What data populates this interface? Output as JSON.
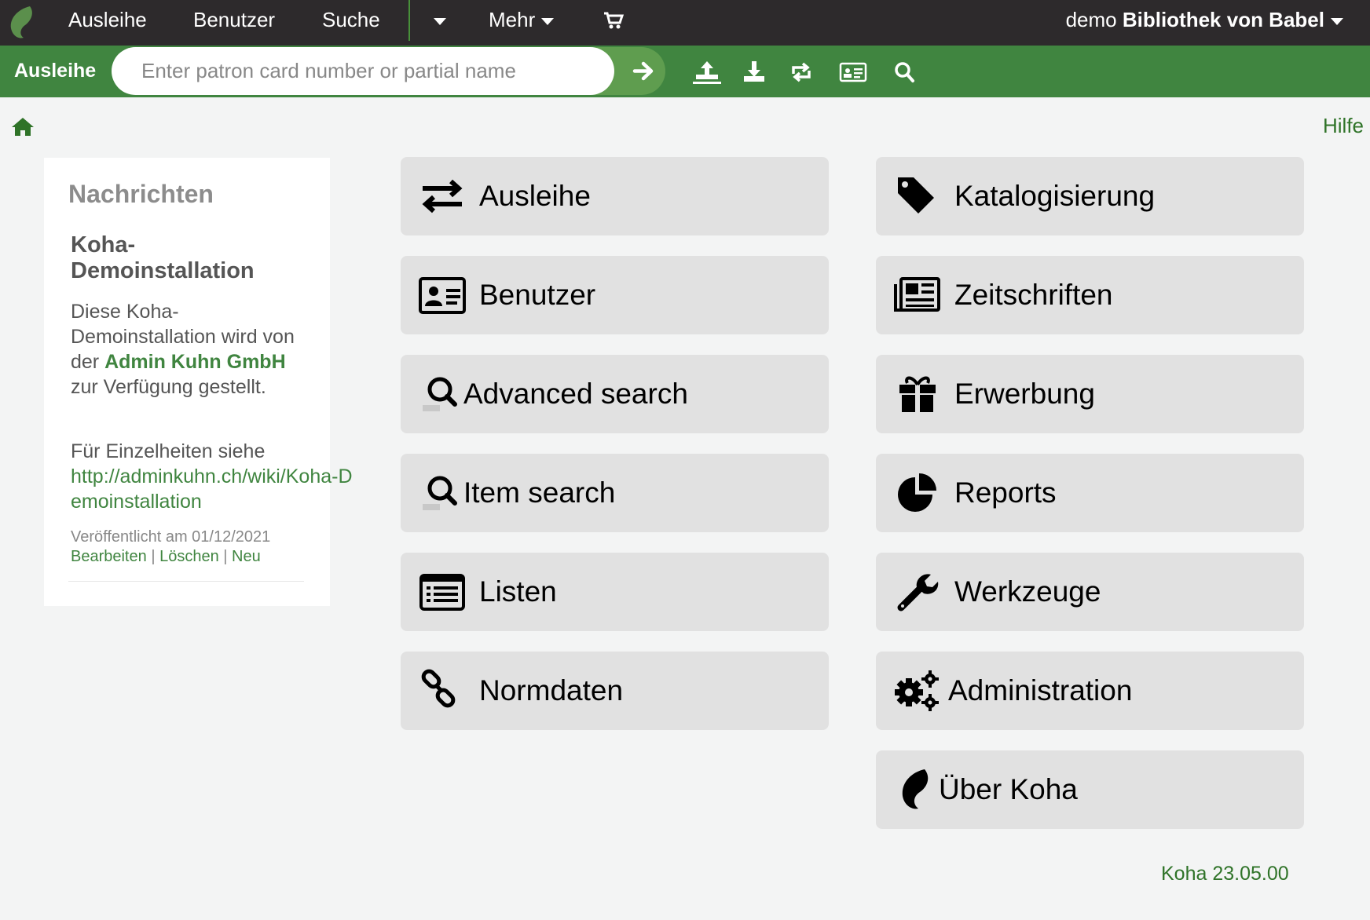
{
  "topnav": {
    "items": [
      "Ausleihe",
      "Benutzer",
      "Suche"
    ],
    "more_label": "Mehr",
    "library_user": "demo",
    "library_name": "Bibliothek von Babel"
  },
  "header": {
    "module_label": "Ausleihe",
    "search_placeholder": "Enter patron card number or partial name",
    "search_value": ""
  },
  "breadcrumb": {
    "help_label": "Hilfe"
  },
  "news": {
    "title": "Nachrichten",
    "item_title": "Koha-Demoinstallation",
    "body_prefix": "Diese Koha-Demoinstallation wird von der ",
    "body_bold": "Admin Kuhn GmbH",
    "body_suffix": " zur Verfügung gestellt.",
    "details_text": "Für Einzelheiten siehe",
    "details_link": "http://adminkuhn.ch/wiki/Koha-Demoinstallation",
    "published": "Veröffentlicht am 01/12/2021",
    "actions": [
      "Bearbeiten",
      "Löschen",
      "Neu"
    ]
  },
  "modules": {
    "left": [
      {
        "label": "Ausleihe",
        "icon": "exchange-icon"
      },
      {
        "label": "Benutzer",
        "icon": "id-card-icon"
      },
      {
        "label": "Advanced search",
        "icon": "search-icon"
      },
      {
        "label": "Item search",
        "icon": "search-icon"
      },
      {
        "label": "Listen",
        "icon": "list-icon"
      },
      {
        "label": "Normdaten",
        "icon": "link-icon"
      }
    ],
    "right": [
      {
        "label": "Katalogisierung",
        "icon": "tag-icon"
      },
      {
        "label": "Zeitschriften",
        "icon": "newspaper-icon"
      },
      {
        "label": "Erwerbung",
        "icon": "gift-icon"
      },
      {
        "label": "Reports",
        "icon": "pie-chart-icon"
      },
      {
        "label": "Werkzeuge",
        "icon": "wrench-icon"
      },
      {
        "label": "Administration",
        "icon": "gears-icon"
      },
      {
        "label": "Über Koha",
        "icon": "koha-logo-icon"
      }
    ]
  },
  "footer": {
    "version": "Koha 23.05.00"
  },
  "colors": {
    "topbar": "#2d2a2c",
    "header_green": "#408540",
    "link_green": "#2f7328",
    "tile": "#e1e1e1",
    "background": "#f3f4f4"
  }
}
